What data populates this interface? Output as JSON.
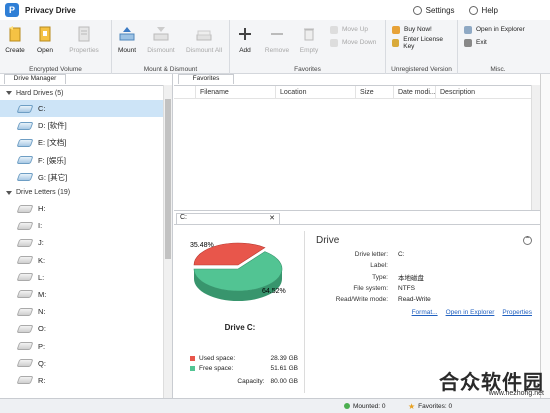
{
  "app": {
    "title": "Privacy Drive"
  },
  "titlebar": {
    "settings": "Settings",
    "help": "Help"
  },
  "ribbon": {
    "groups": [
      {
        "label": "Encrypted Volume",
        "buttons": [
          "Create",
          "Open",
          "Properties"
        ]
      },
      {
        "label": "Mount & Dismount",
        "buttons": [
          "Mount",
          "Dismount",
          "Dismount All"
        ]
      },
      {
        "label": "Favorites",
        "buttons": [
          "Add",
          "Remove",
          "Empty"
        ],
        "small": [
          "Move Up",
          "Move Down"
        ]
      },
      {
        "label": "Unregistered Version",
        "small": [
          "Buy Now!",
          "Enter License Key"
        ]
      },
      {
        "label": "Misc.",
        "small": [
          "Open in Explorer",
          "Exit"
        ]
      }
    ]
  },
  "left": {
    "tab": "Drive Manager",
    "hard_drives_header": "Hard Drives (5)",
    "hard_drives": [
      "C:",
      "D: [软件]",
      "E: [文档]",
      "F: [娱乐]",
      "G: [其它]"
    ],
    "drive_letters_header": "Drive Letters (19)",
    "drive_letters": [
      "H:",
      "I:",
      "J:",
      "K:",
      "L:",
      "M:",
      "N:",
      "O:",
      "P:",
      "Q:",
      "R:"
    ]
  },
  "favorites": {
    "tab": "Favorites",
    "columns": [
      "Filename",
      "Location",
      "Size",
      "Date modi...",
      "Description"
    ]
  },
  "detail": {
    "tab": "C:",
    "drive_title": "Drive C:",
    "pie_used_label": "35.48%",
    "pie_free_label": "64.52%",
    "legend": [
      {
        "label": "Used space:",
        "value": "28.39 GB",
        "color": "#e8564b"
      },
      {
        "label": "Free space:",
        "value": "51.61 GB",
        "color": "#52c493"
      }
    ],
    "capacity_label": "Capacity:",
    "capacity_value": "80.00 GB",
    "props_title": "Drive",
    "props": [
      {
        "k": "Drive letter:",
        "v": "C:"
      },
      {
        "k": "Label:",
        "v": ""
      },
      {
        "k": "Type:",
        "v": "本地磁盘"
      },
      {
        "k": "File system:",
        "v": "NTFS"
      },
      {
        "k": "Read/Write mode:",
        "v": "Read-Write"
      }
    ],
    "links": [
      "Format...",
      "Open in Explorer",
      "Properties"
    ]
  },
  "status": {
    "mounted": "Mounted: 0",
    "favorites": "Favorites: 0"
  },
  "watermark": {
    "main": "合众软件园",
    "sub": "www.hezhong.net"
  },
  "chart_data": {
    "type": "pie",
    "categories": [
      "Used space",
      "Free space"
    ],
    "values": [
      35.48,
      64.52
    ],
    "colors": [
      "#e8564b",
      "#52c493"
    ]
  }
}
